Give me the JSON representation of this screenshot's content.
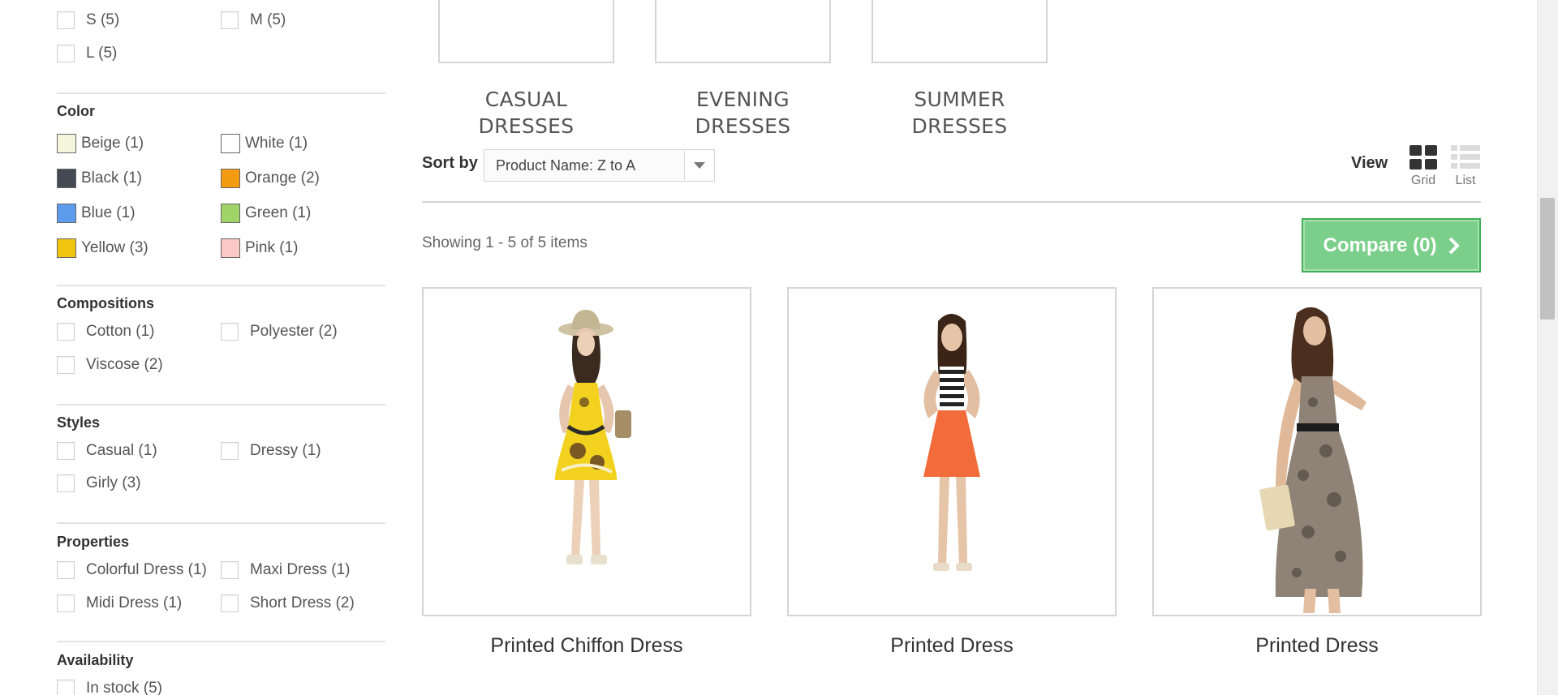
{
  "filters": {
    "size": {
      "options": [
        {
          "label": "S (5)"
        },
        {
          "label": "M (5)"
        },
        {
          "label": "L (5)"
        }
      ]
    },
    "color": {
      "title": "Color",
      "options": [
        {
          "label": "Beige (1)",
          "hex": "#f5f5dc"
        },
        {
          "label": "White (1)",
          "hex": "#ffffff"
        },
        {
          "label": "Black (1)",
          "hex": "#434a54"
        },
        {
          "label": "Orange (2)",
          "hex": "#f39c11"
        },
        {
          "label": "Blue (1)",
          "hex": "#5d9cec"
        },
        {
          "label": "Green (1)",
          "hex": "#a0d468"
        },
        {
          "label": "Yellow (3)",
          "hex": "#f1c40f"
        },
        {
          "label": "Pink (1)",
          "hex": "#fcc7c7"
        }
      ]
    },
    "compositions": {
      "title": "Compositions",
      "options": [
        {
          "label": "Cotton (1)"
        },
        {
          "label": "Polyester (2)"
        },
        {
          "label": "Viscose (2)"
        }
      ]
    },
    "styles": {
      "title": "Styles",
      "options": [
        {
          "label": "Casual (1)"
        },
        {
          "label": "Dressy (1)"
        },
        {
          "label": "Girly (3)"
        }
      ]
    },
    "properties": {
      "title": "Properties",
      "options": [
        {
          "label": "Colorful Dress (1)"
        },
        {
          "label": "Maxi Dress (1)"
        },
        {
          "label": "Midi Dress (1)"
        },
        {
          "label": "Short Dress (2)"
        }
      ]
    },
    "availability": {
      "title": "Availability",
      "options": [
        {
          "label": "In stock (5)"
        }
      ]
    }
  },
  "subcategories": [
    {
      "line1": "CASUAL",
      "line2": "DRESSES"
    },
    {
      "line1": "EVENING",
      "line2": "DRESSES"
    },
    {
      "line1": "SUMMER",
      "line2": "DRESSES"
    }
  ],
  "toolbar": {
    "sort_label": "Sort by",
    "sort_value": "Product Name: Z to A",
    "view_label": "View",
    "grid_label": "Grid",
    "list_label": "List",
    "showing": "Showing 1 - 5 of 5 items",
    "compare_label": "Compare (0)"
  },
  "products": [
    {
      "name": "Printed Chiffon Dress"
    },
    {
      "name": "Printed Dress"
    },
    {
      "name": "Printed Dress"
    }
  ],
  "colors": {
    "compare_green": "#7bcf8a",
    "border_gray": "#d6d4d4"
  }
}
